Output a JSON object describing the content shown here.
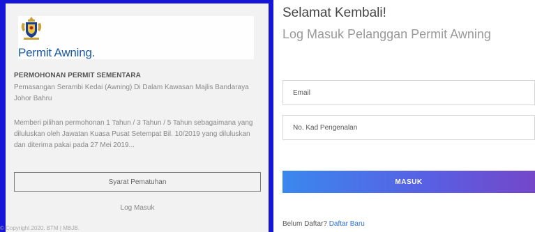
{
  "brand": {
    "name": "Permit Awning.",
    "crest_icon": "crest-icon"
  },
  "info": {
    "title": "PERMOHONAN PERMIT SEMENTARA",
    "subtitle": "Pemasangan Serambi Kedai (Awning) Di Dalam Kawasan Majlis Bandaraya Johor Bahru",
    "description": "Memberi pilihan permohonan 1 Tahun / 3 Tahun / 5 Tahun sebagaimana yang diluluskan oleh Jawatan Kuasa Pusat Setempat Bil. 10/2019 yang diluluskan dan diterima pakai pada 27 Mei 2019...",
    "syarat_button": "Syarat Pematuhan",
    "log_link": "Log Masuk",
    "copyright": "© Copyright 2020. BTM | MBJB."
  },
  "login": {
    "welcome": "Selamat Kembali!",
    "subtitle": "Log Masuk Pelanggan Permit Awning",
    "email_placeholder": "Email",
    "ic_placeholder": "No. Kad Pengenalan",
    "submit_label": "MASUK",
    "signup_prompt": "Belum Daftar?",
    "signup_link": "Daftar Baru"
  },
  "colors": {
    "background": "#1616d8",
    "brand": "#1b5aa6",
    "link": "#2a6fd6",
    "button_gradient_start": "#3a88ee",
    "button_gradient_end": "#7447c8"
  }
}
